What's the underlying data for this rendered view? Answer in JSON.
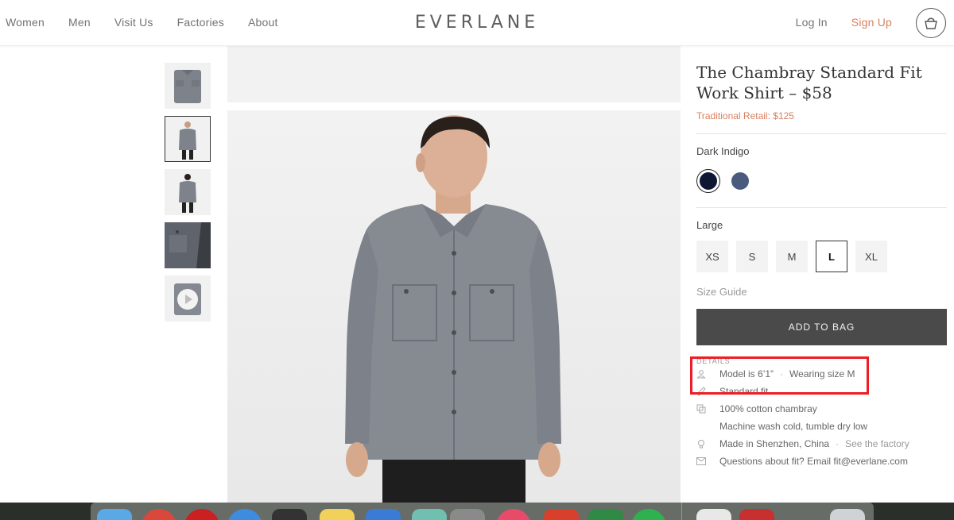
{
  "nav": {
    "left_links": [
      "Women",
      "Men",
      "Visit Us",
      "Factories",
      "About"
    ],
    "brand": "EVERLANE",
    "login": "Log In",
    "signup": "Sign Up",
    "cart_icon": "shopping-bag-icon"
  },
  "product": {
    "title": "The Chambray Standard Fit Work Shirt – $58",
    "traditional_retail": "Traditional Retail: $125",
    "color_label": "Dark Indigo",
    "swatches": [
      {
        "name": "Dark Indigo",
        "hex": "#0e1733",
        "selected": true
      },
      {
        "name": "Blue",
        "hex": "#4a5b7d",
        "selected": false
      }
    ],
    "size_label": "Large",
    "sizes": [
      "XS",
      "S",
      "M",
      "L",
      "XL"
    ],
    "selected_size": "L",
    "size_guide": "Size Guide",
    "add_to_bag": "ADD TO BAG"
  },
  "details": {
    "label": "DETAILS",
    "model_height": "Model is 6’1”",
    "wearing": "Wearing size M",
    "fit": "Standard fit",
    "material": "100% cotton chambray",
    "care": "Machine wash cold, tumble dry low",
    "origin": "Made in Shenzhen, China",
    "factory_link": "See the factory",
    "questions": "Questions about fit? Email fit@everlane.com"
  },
  "colors": {
    "accent": "#d9805f",
    "button": "#4a4a4a",
    "highlight": "#ee1c25",
    "shirt": "#868b92"
  },
  "dock": {
    "icons": [
      "finder-icon",
      "chrome-icon",
      "opera-icon",
      "safari-icon",
      "app-store-icon",
      "notes-icon",
      "stocks-icon",
      "maps-icon",
      "preview-icon",
      "itunes-icon",
      "acrobat-icon",
      "excel-icon",
      "spotify-icon",
      "documents-icon",
      "gallery-icon",
      "trash-icon"
    ]
  }
}
